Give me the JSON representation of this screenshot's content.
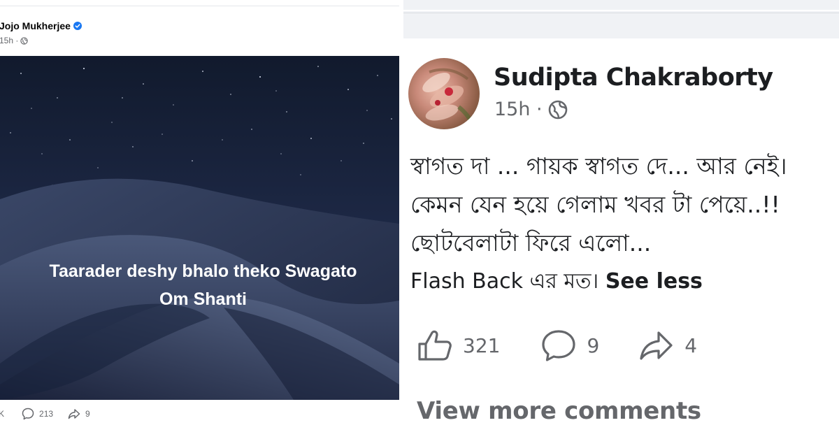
{
  "left_post": {
    "author": "Jojo Mukherjee",
    "time": "15h ·",
    "caption_line1": "Taarader deshy bhalo theko Swagato",
    "caption_line2": "Om Shanti",
    "reactions": "K",
    "comments": "213",
    "shares": "9"
  },
  "right_post": {
    "author": "Sudipta Chakraborty",
    "time": "15h ·",
    "body_lines": [
      "স্বাগত দা ... গায়ক স্বাগত দে... আর নেই।",
      "কেমন যেন হয়ে গেলাম খবর টা পেয়ে..!!",
      "ছোটবেলাটা ফিরে এলো..."
    ],
    "last_line": "Flash Back এর মত।",
    "see_less": "See less",
    "likes": "321",
    "comments": "9",
    "shares": "4",
    "view_more": "View more comments"
  },
  "colors": {
    "facebook_blue": "#1877f2",
    "secondary_text": "#65676b",
    "night_sky": "#1b2540"
  },
  "icons": [
    "verified-badge-icon",
    "globe-icon",
    "like-icon",
    "comment-icon",
    "share-icon"
  ]
}
